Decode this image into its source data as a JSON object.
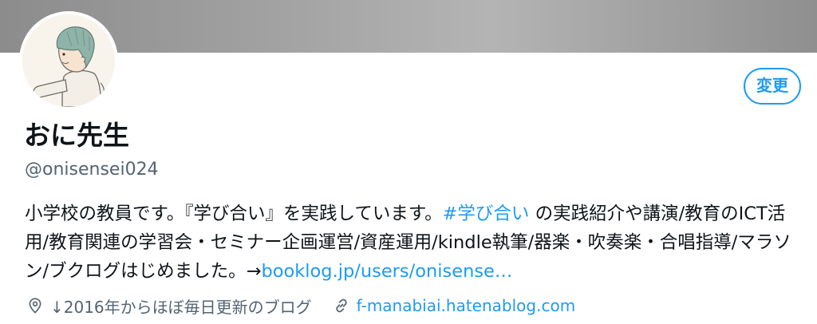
{
  "profile": {
    "display_name": "おに先生",
    "handle": "@onisensei024",
    "edit_button_label": "変更",
    "bio": {
      "text_1": "小学校の教員です。『学び合い』を実践しています。",
      "hashtag": "#学び合い",
      "text_2": " の実践紹介や講演/教育のICT活用/教育関連の学習会・セミナー企画運営/資産運用/kindle執筆/器楽・吹奏楽・合唱指導/マラソン/ブクログはじめました。→",
      "link": "booklog.jp/users/onisense…"
    },
    "location": "↓2016年からほぼ毎日更新のブログ",
    "website": "f-manabiai.hatenablog.com"
  },
  "colors": {
    "accent": "#1d9bf0",
    "text_primary": "#0f1419",
    "text_secondary": "#536471"
  },
  "icons": {
    "location": "location-pin-icon",
    "website": "link-icon"
  }
}
